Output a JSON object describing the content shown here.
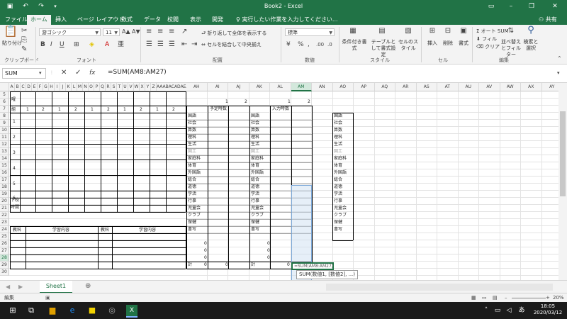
{
  "titlebar": {
    "title": "Book2 - Excel",
    "save_icon": "save-icon",
    "undo_icon": "undo-icon",
    "redo_icon": "redo-icon"
  },
  "tabs": [
    "ファイル",
    "ホーム",
    "挿入",
    "ページ レイアウト",
    "数式",
    "データ",
    "校閲",
    "表示",
    "開発"
  ],
  "tell_me": "実行したい作業を入力してください...",
  "share": "共有",
  "ribbon": {
    "clipboard": {
      "paste": "貼り付け",
      "label": "クリップボード"
    },
    "font": {
      "name": "游ゴシック",
      "size": "11",
      "label": "フォント"
    },
    "alignment": {
      "wrap": "折り返して全体を表示する",
      "merge": "セルを結合して中央揃え",
      "label": "配置"
    },
    "number": {
      "format": "標準",
      "label": "数値"
    },
    "styles": {
      "conditional": "条件付き書式",
      "table": "テーブルとして書式設定",
      "cell": "セルのスタイル",
      "label": "スタイル"
    },
    "cells": {
      "insert": "挿入",
      "delete": "削除",
      "format": "書式",
      "label": "セル"
    },
    "editing": {
      "autosum": "オート SUM",
      "fill": "フィル",
      "clear": "クリア",
      "sort": "並べ替えとフィルター",
      "find": "検索と選択",
      "label": "編集"
    }
  },
  "formula_bar": {
    "name_box": "SUM",
    "formula": "=SUM(AM8:AM27)"
  },
  "columns_left": [
    "A",
    "B",
    "C",
    "D",
    "E",
    "F",
    "G",
    "H",
    "I",
    "J",
    "K",
    "L",
    "M",
    "N",
    "O",
    "P",
    "Q",
    "R",
    "S",
    "T",
    "U",
    "V",
    "W",
    "X",
    "Y",
    "Z",
    "AAABACADAEAFAG"
  ],
  "columns_right": [
    "AH",
    "AI",
    "AJ",
    "AK",
    "AL",
    "AM",
    "AN",
    "AO",
    "AP",
    "AQ",
    "AR",
    "AS",
    "AT",
    "AU",
    "AV",
    "AW",
    "AX",
    "AY"
  ],
  "rows": [
    "5",
    "6",
    "7",
    "8",
    "9",
    "10",
    "11",
    "12",
    "13",
    "14",
    "15",
    "16",
    "17",
    "18",
    "19",
    "20",
    "21",
    "22",
    "23",
    "24",
    "25",
    "26",
    "27",
    "28",
    "29",
    "30"
  ],
  "left_table": {
    "header_row": [
      "1",
      "2",
      "1",
      "2",
      "1",
      "2",
      "1",
      "2",
      "1",
      "2"
    ],
    "row6_label": "曜",
    "row7_label": "組",
    "period_labels": [
      "1",
      "2",
      "3",
      "4",
      "5",
      "6"
    ],
    "bottom_label1": "下校",
    "bottom_label2": "時間",
    "footer_headers": [
      "教科",
      "学習内容",
      "教科",
      "学習内容"
    ]
  },
  "plan_table": {
    "header_nums": [
      "1",
      "2",
      "1",
      "2"
    ],
    "plan_title": "予定時数",
    "input_title": "入力時数",
    "subjects": [
      "国語",
      "社会",
      "算数",
      "理科",
      "生活",
      "図工",
      "家庭科",
      "体育",
      "外国語",
      "総合",
      "道徳",
      "学活",
      "行事",
      "児童会",
      "クラブ",
      "保健",
      "書写"
    ],
    "zeros": [
      "0",
      "0",
      "0"
    ],
    "total_label": "計",
    "totals": [
      "0",
      "0",
      "0"
    ],
    "edit_text": "=SUM(AM8:AM27)",
    "tooltip": "SUM(数値1, [数値2], ...)"
  },
  "subject_list": [
    "国語",
    "社会",
    "算数",
    "理科",
    "生活",
    "図工",
    "家庭科",
    "体育",
    "外国語",
    "総合",
    "道徳",
    "学活",
    "行事",
    "児童会",
    "クラブ",
    "保健",
    "書写"
  ],
  "sheet": {
    "name": "Sheet1",
    "add_icon": "plus-icon"
  },
  "status": {
    "mode": "編集",
    "zoom": "20%"
  },
  "taskbar": {
    "time": "18:05",
    "date": "2020/03/12",
    "ime": "あ"
  }
}
